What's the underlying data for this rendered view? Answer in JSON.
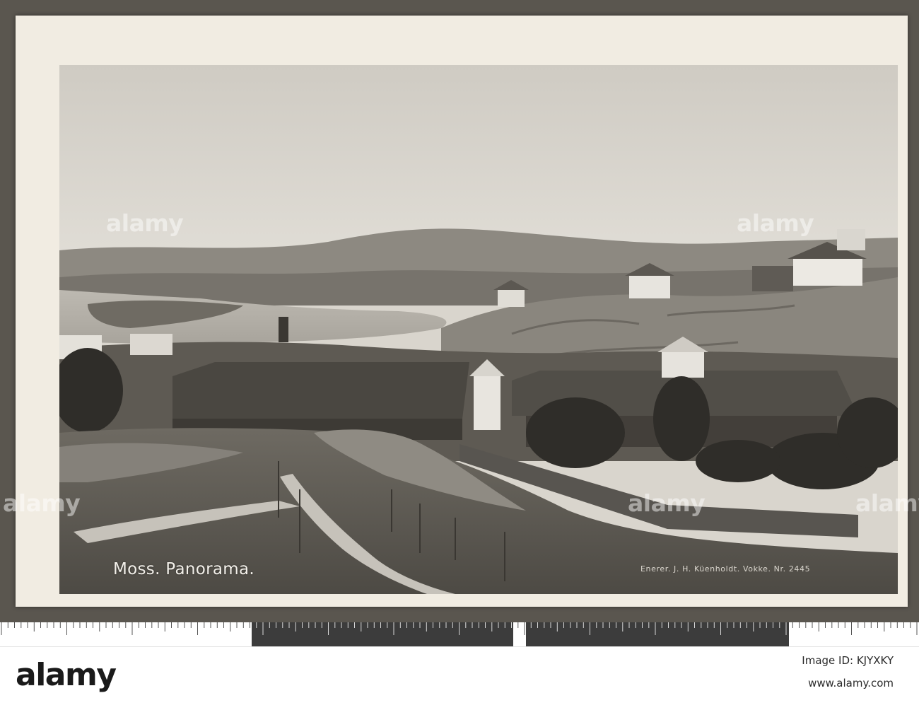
{
  "postcard": {
    "caption": "Moss. Panorama.",
    "publisher_line": "Enerer. J. H. Küenholdt. Vokke. Nr. 2445"
  },
  "watermark": {
    "text": "alamy"
  },
  "footer": {
    "logo": "alamy",
    "image_id": "Image ID: KJYXKY",
    "url": "www.alamy.com"
  },
  "colors": {
    "card": "#f1ece2",
    "backdrop": "#5a564f",
    "sky": "#d9d5cd"
  }
}
